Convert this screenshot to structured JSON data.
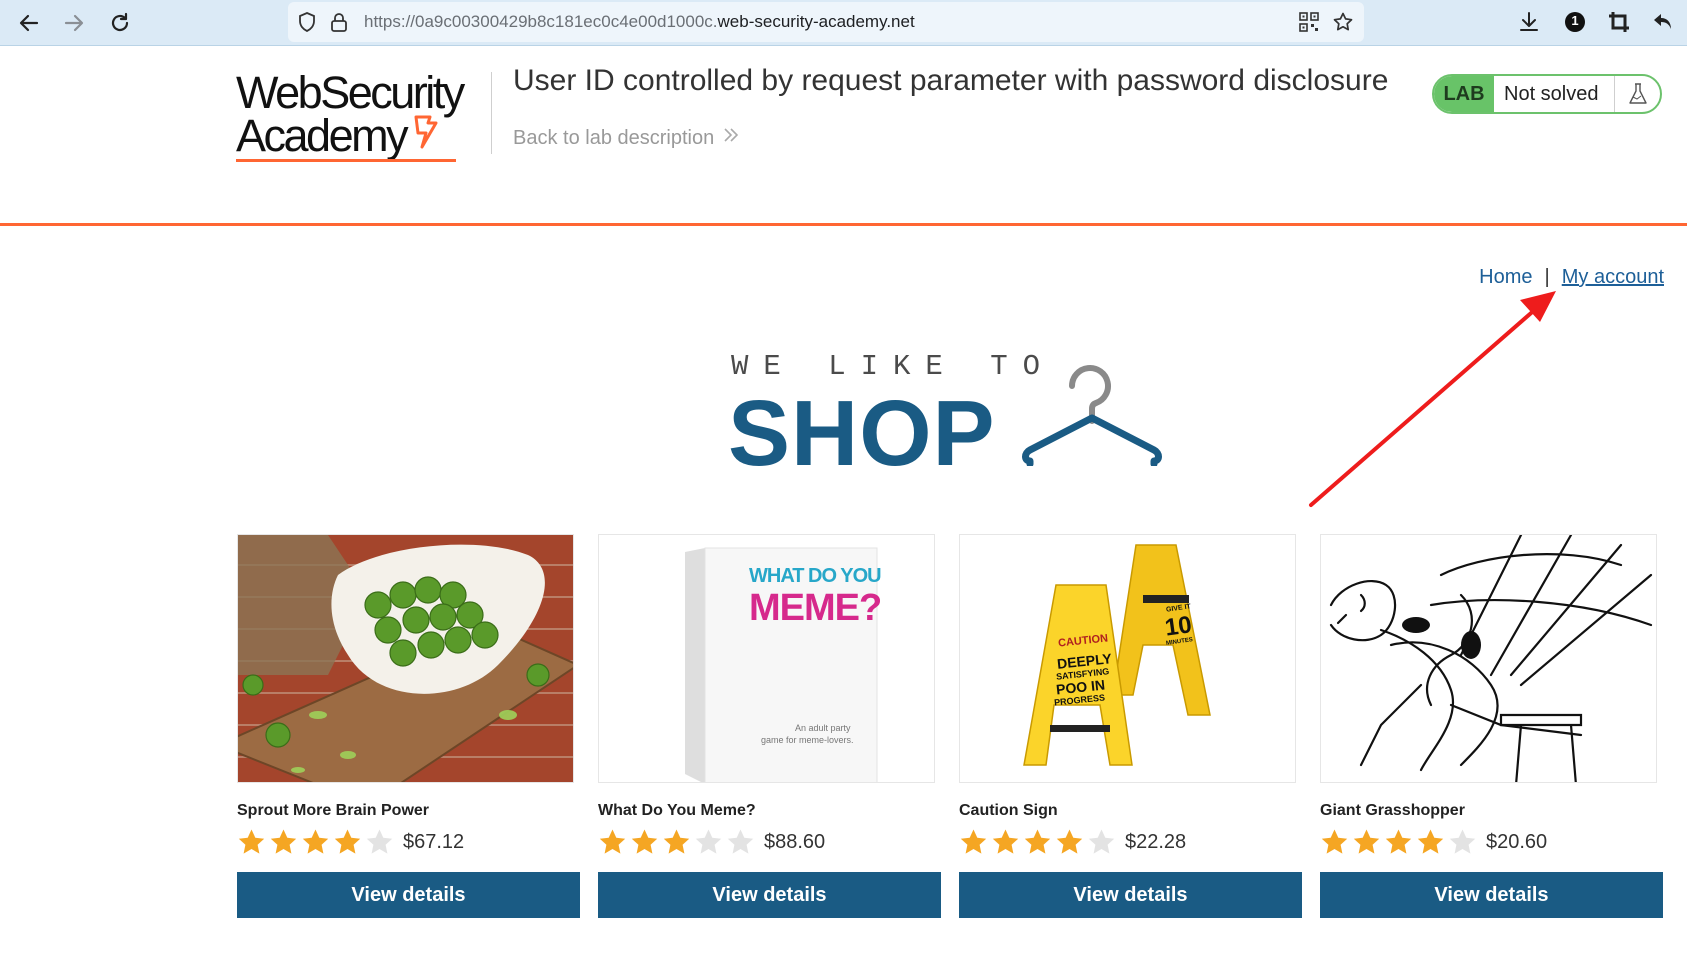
{
  "browser": {
    "url_prefix": "https://0a9c00300429b8c181ec0c4e00d1000c.",
    "url_domain": "web-security-academy.net",
    "profile_badge": "1"
  },
  "header": {
    "logo_line1": "WebSecurity",
    "logo_line2": "Academy",
    "lab_title": "User ID controlled by request parameter with password disclosure",
    "back_link": "Back to lab description",
    "lab_badge": "LAB",
    "lab_status": "Not solved",
    "accent_color": "#ff6633",
    "status_color": "#68c368"
  },
  "nav": {
    "home": "Home",
    "separator": "|",
    "my_account": "My account"
  },
  "hero": {
    "tagline": "WE LIKE TO",
    "title": "SHOP"
  },
  "products": [
    {
      "name": "Sprout More Brain Power",
      "price": "$67.12",
      "rating": 4,
      "button": "View details"
    },
    {
      "name": "What Do You Meme?",
      "price": "$88.60",
      "rating": 3,
      "button": "View details"
    },
    {
      "name": "Caution Sign",
      "price": "$22.28",
      "rating": 4,
      "button": "View details"
    },
    {
      "name": "Giant Grasshopper",
      "price": "$20.60",
      "rating": 4,
      "button": "View details"
    }
  ],
  "product_images": {
    "meme_box_line1": "WHAT DO YOU",
    "meme_box_line2": "MEME?",
    "meme_box_footer1": "An adult party",
    "meme_box_footer2": "game for meme-lovers.",
    "sign_left_1": "CAUTION",
    "sign_left_2": "DEEPLY",
    "sign_left_3": "SATISFYING",
    "sign_left_4": "POO IN",
    "sign_left_5": "PROGRESS",
    "sign_right_1": "GIVE IT",
    "sign_right_2": "10",
    "sign_right_3": "MINUTES"
  }
}
